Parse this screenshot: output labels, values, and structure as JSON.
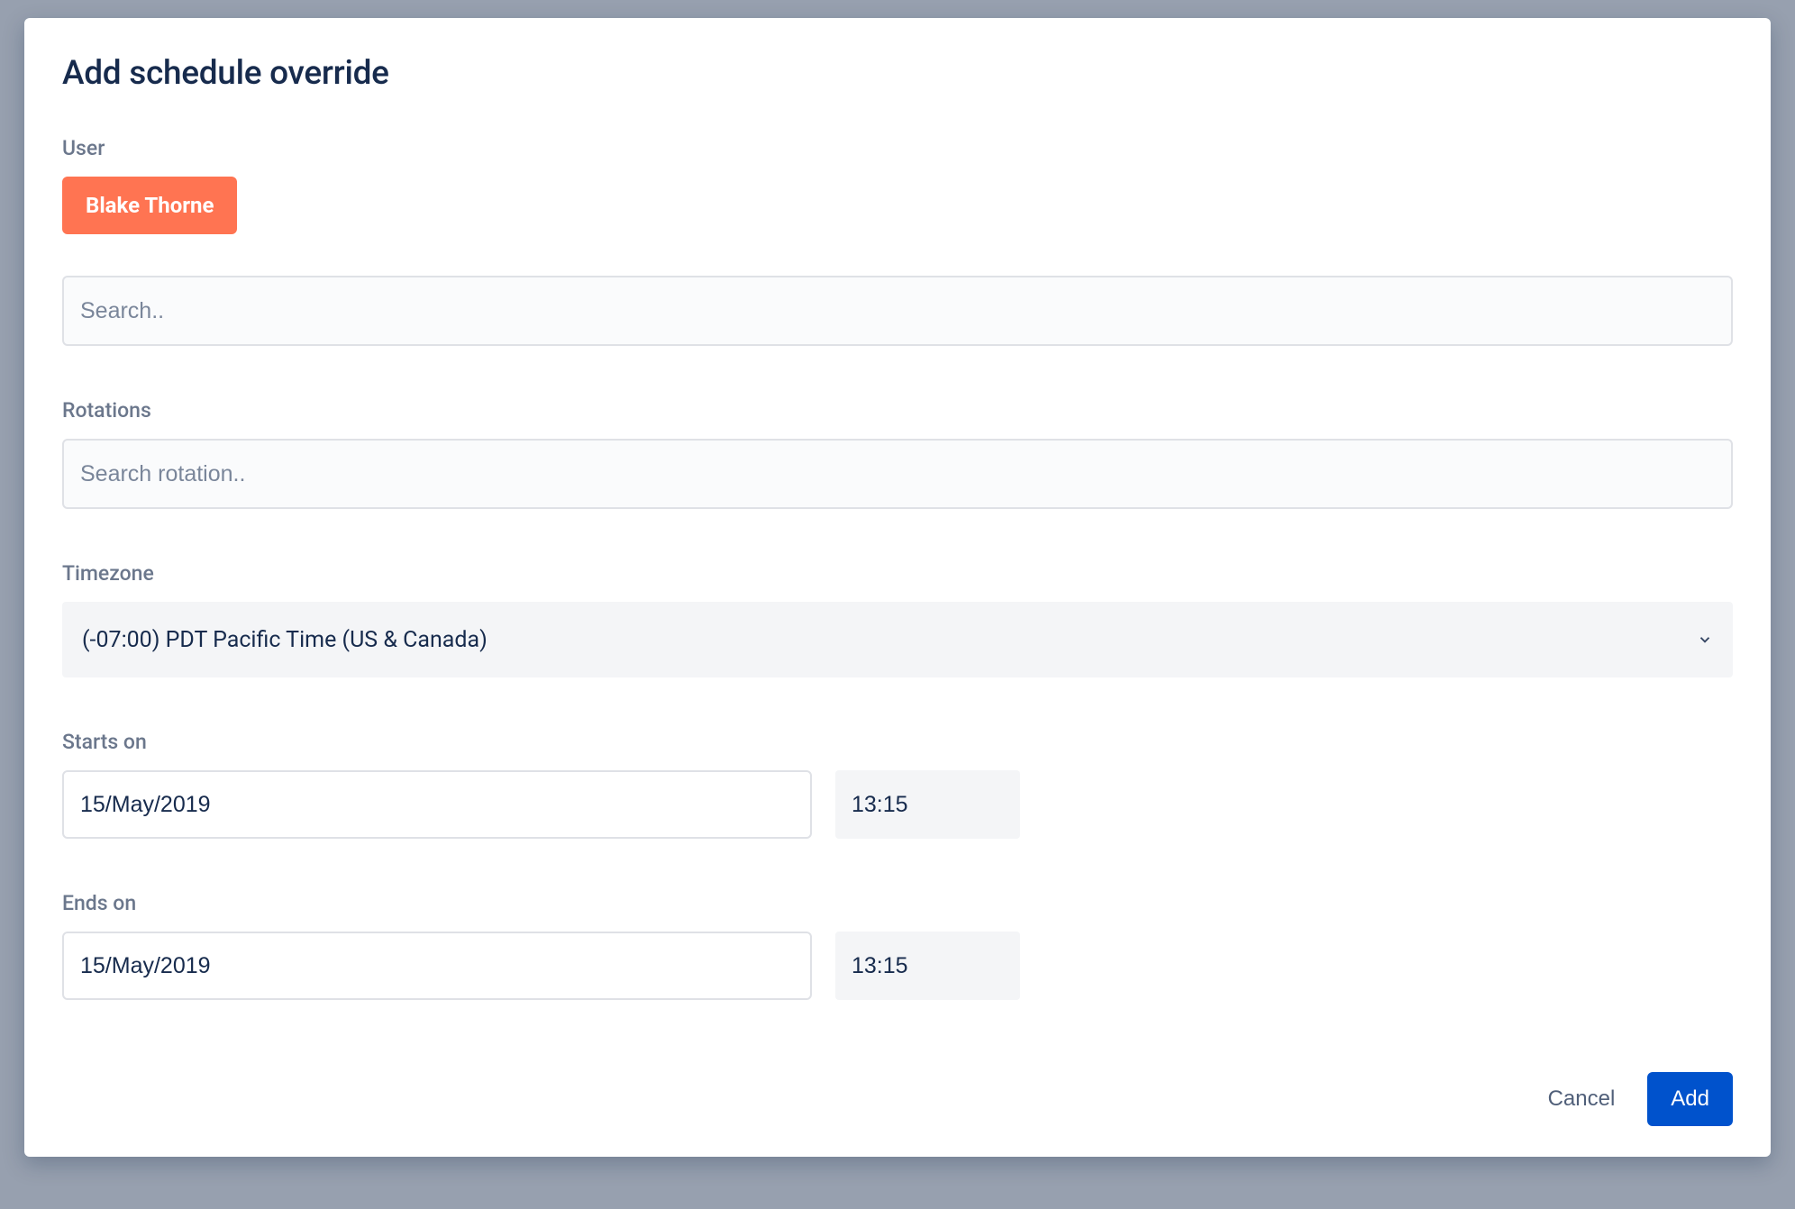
{
  "modal": {
    "title": "Add schedule override",
    "user": {
      "label": "User",
      "selected_name": "Blake Thorne",
      "search_placeholder": "Search.."
    },
    "rotations": {
      "label": "Rotations",
      "search_placeholder": "Search rotation.."
    },
    "timezone": {
      "label": "Timezone",
      "value": "(-07:00) PDT Pacific Time (US & Canada)"
    },
    "starts_on": {
      "label": "Starts on",
      "date": "15/May/2019",
      "time": "13:15"
    },
    "ends_on": {
      "label": "Ends on",
      "date": "15/May/2019",
      "time": "13:15"
    },
    "footer": {
      "cancel_label": "Cancel",
      "add_label": "Add"
    }
  }
}
